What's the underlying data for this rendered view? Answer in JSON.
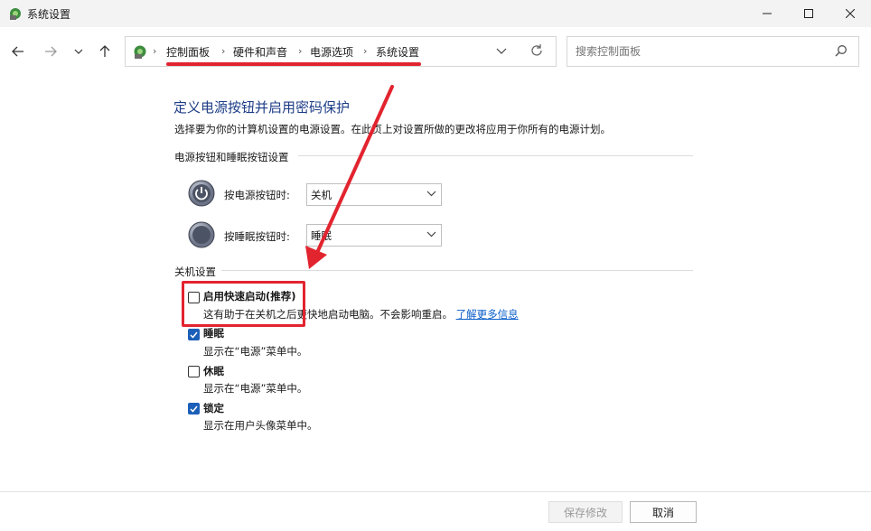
{
  "window": {
    "title": "系统设置",
    "colors": {
      "accent": "#1c5fb8",
      "title": "#1e3d87",
      "link": "#0b5ec9",
      "annotation": "#e2242f"
    }
  },
  "nav": {
    "back_icon": "arrow-left-icon",
    "forward_icon": "arrow-right-icon",
    "recent_icon": "chevron-down-icon",
    "up_icon": "arrow-up-icon"
  },
  "breadcrumb": [
    "控制面板",
    "硬件和声音",
    "电源选项",
    "系统设置"
  ],
  "search": {
    "placeholder": "搜索控制面板"
  },
  "content": {
    "title": "定义电源按钮并启用密码保护",
    "description": "选择要为你的计算机设置的电源设置。在此页上对设置所做的更改将应用于你所有的电源计划。",
    "section_buttons": "电源按钮和睡眠按钮设置",
    "power_button": {
      "label": "按电源按钮时:",
      "value": "关机"
    },
    "sleep_button": {
      "label": "按睡眠按钮时:",
      "value": "睡眠"
    },
    "section_shutdown": "关机设置",
    "options": [
      {
        "title": "启用快速启动(推荐)",
        "desc": "这有助于在关机之后更快地启动电脑。不会影响重启。",
        "link": "了解更多信息",
        "checked": false
      },
      {
        "title": "睡眠",
        "desc": "显示在“电源”菜单中。",
        "checked": true
      },
      {
        "title": "休眠",
        "desc": "显示在“电源”菜单中。",
        "checked": false
      },
      {
        "title": "锁定",
        "desc": "显示在用户头像菜单中。",
        "checked": true
      }
    ]
  },
  "footer": {
    "save": "保存修改",
    "cancel": "取消"
  }
}
